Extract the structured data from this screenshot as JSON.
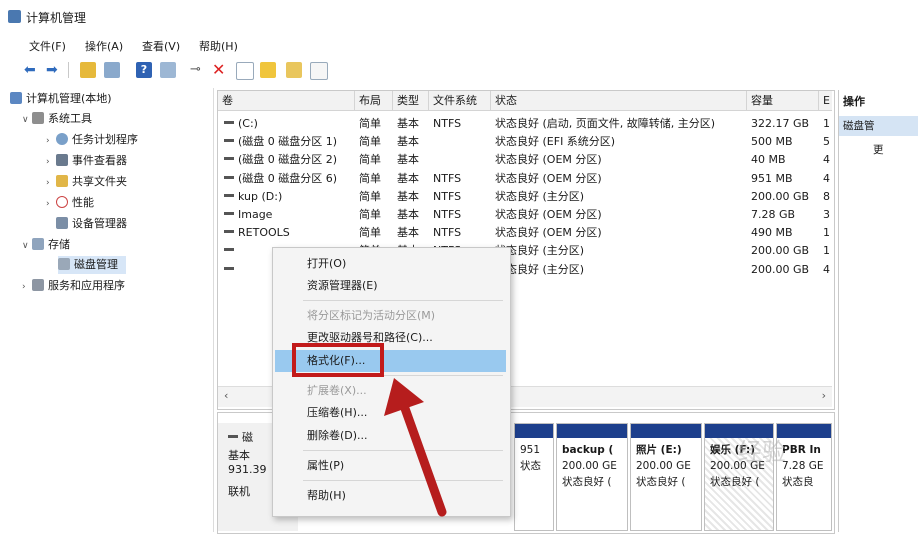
{
  "window": {
    "title": "计算机管理"
  },
  "menu": [
    "文件(F)",
    "操作(A)",
    "查看(V)",
    "帮助(H)"
  ],
  "tree": {
    "root": "计算机管理(本地)",
    "system_tools": "系统工具",
    "task_scheduler": "任务计划程序",
    "event_viewer": "事件查看器",
    "shared_folders": "共享文件夹",
    "performance": "性能",
    "device_manager": "设备管理器",
    "storage": "存储",
    "disk_management": "磁盘管理",
    "services_apps": "服务和应用程序"
  },
  "table": {
    "headers": [
      "卷",
      "布局",
      "类型",
      "文件系统",
      "状态",
      "容量",
      "E"
    ],
    "rows": [
      [
        "(C:)",
        "简单",
        "基本",
        "NTFS",
        "状态良好 (启动, 页面文件, 故障转储, 主分区)",
        "322.17 GB",
        "1"
      ],
      [
        "(磁盘 0 磁盘分区 1)",
        "简单",
        "基本",
        "",
        "状态良好 (EFI 系统分区)",
        "500 MB",
        "5"
      ],
      [
        "(磁盘 0 磁盘分区 2)",
        "简单",
        "基本",
        "",
        "状态良好 (OEM 分区)",
        "40 MB",
        "4"
      ],
      [
        "(磁盘 0 磁盘分区 6)",
        "简单",
        "基本",
        "NTFS",
        "状态良好 (OEM 分区)",
        "951 MB",
        "4"
      ],
      [
        "kup (D:)",
        "简单",
        "基本",
        "NTFS",
        "状态良好 (主分区)",
        "200.00 GB",
        "8"
      ],
      [
        "Image",
        "简单",
        "基本",
        "NTFS",
        "状态良好 (OEM 分区)",
        "7.28 GB",
        "3"
      ],
      [
        "RETOOLS",
        "简单",
        "基本",
        "NTFS",
        "状态良好 (OEM 分区)",
        "490 MB",
        "1"
      ],
      [
        "",
        "简单",
        "基本",
        "NTFS",
        "状态良好 (主分区)",
        "200.00 GB",
        "1"
      ],
      [
        "",
        "",
        "",
        "",
        "状态良好 (主分区)",
        "200.00 GB",
        "4"
      ]
    ]
  },
  "actions": {
    "header": "操作",
    "item1": "磁盘管",
    "item2": "更"
  },
  "bottom": {
    "disk_name": "磁",
    "disk_type": "基本",
    "disk_size": "931.39",
    "disk_status": "联机",
    "partitions": [
      {
        "line1": "",
        "line2": "951",
        "line3": "状态"
      },
      {
        "line1": "backup (",
        "line2": "200.00 GE",
        "line3": "状态良好 ("
      },
      {
        "line1": "照片 (E:)",
        "line2": "200.00 GE",
        "line3": "状态良好 ("
      },
      {
        "line1": "娱乐 (F:)",
        "line2": "200.00 GE",
        "line3": "状态良好 ("
      },
      {
        "line1": "PBR In",
        "line2": "7.28 GE",
        "line3": "状态良"
      }
    ]
  },
  "context_menu": {
    "open": "打开(O)",
    "explorer": "资源管理器(E)",
    "mark_active": "将分区标记为活动分区(M)",
    "change_letter": "更改驱动器号和路径(C)...",
    "format": "格式化(F)...",
    "extend": "扩展卷(X)...",
    "shrink": "压缩卷(H)...",
    "delete": "删除卷(D)...",
    "properties": "属性(P)",
    "help": "帮助(H)"
  },
  "watermark": "经验",
  "colors": {
    "highlight": "#99c9ef",
    "annotation_red": "#c21a1a",
    "partition_bar": "#1d3f8c"
  }
}
